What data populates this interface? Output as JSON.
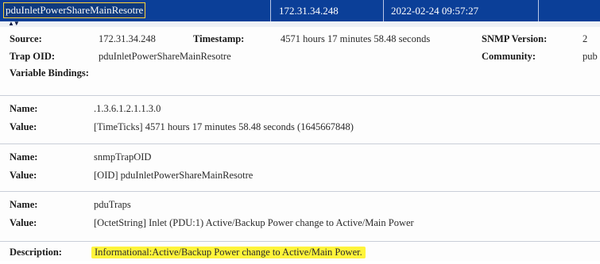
{
  "title_row": {
    "trap_name": "pduInletPowerShareMainResotre",
    "ip": "172.31.34.248",
    "datetime": "2022-02-24 09:57:27"
  },
  "sort_indicator": "▲▼",
  "details": {
    "source_label": "Source:",
    "source_value": "172.31.34.248",
    "timestamp_label": "Timestamp:",
    "timestamp_value": "4571 hours 17 minutes 58.48 seconds",
    "snmp_version_label": "SNMP Version:",
    "snmp_version_value": "2",
    "trap_oid_label": "Trap OID:",
    "trap_oid_value": "pduInletPowerShareMainResotre",
    "community_label": "Community:",
    "community_value": "pub",
    "variable_bindings_label": "Variable Bindings:"
  },
  "bindings": [
    {
      "name_label": "Name:",
      "name": ".1.3.6.1.2.1.1.3.0",
      "value_label": "Value:",
      "value": "[TimeTicks] 4571 hours 17 minutes 58.48 seconds (1645667848)"
    },
    {
      "name_label": "Name:",
      "name": "snmpTrapOID",
      "value_label": "Value:",
      "value": "[OID] pduInletPowerShareMainResotre"
    },
    {
      "name_label": "Name:",
      "name": "pduTraps",
      "value_label": "Value:",
      "value": "[OctetString] Inlet (PDU:1) Active/Backup Power change to Active/Main Power"
    }
  ],
  "description": {
    "label": "Description:",
    "text": "Informational:Active/Backup Power change to Active/Main Power."
  },
  "colors": {
    "titlebar_bg": "#0b3f98",
    "highlight": "#fff43a",
    "selection_outline": "#ffd43a"
  }
}
